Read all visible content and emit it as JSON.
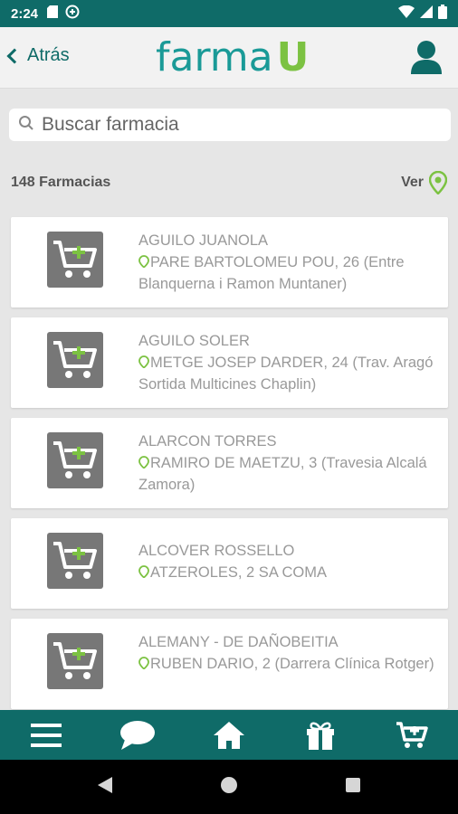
{
  "status_bar": {
    "time": "2:24",
    "icons": [
      "sd-card-icon",
      "sync-icon",
      "wifi-icon",
      "signal-icon",
      "battery-icon"
    ]
  },
  "header": {
    "back_label": "Atrás",
    "logo_main": "farma",
    "logo_accent": "U",
    "profile_icon": "user-icon"
  },
  "search": {
    "placeholder": "Buscar farmacia",
    "value": ""
  },
  "results": {
    "count_label": "148 Farmacias",
    "view_label": "Ver"
  },
  "pharmacies": [
    {
      "name": "AGUILO JUANOLA",
      "address": "PARE BARTOLOMEU POU, 26 (Entre Blanquerna i Ramon Muntaner)"
    },
    {
      "name": "AGUILO SOLER",
      "address": "METGE JOSEP DARDER, 24 (Trav. Aragó Sortida Multicines Chaplin)"
    },
    {
      "name": "ALARCON TORRES",
      "address": "RAMIRO DE MAETZU, 3 (Travesia Alcalá Zamora)"
    },
    {
      "name": "ALCOVER ROSSELLO",
      "address": "ATZEROLES, 2 SA COMA"
    },
    {
      "name": "ALEMANY - DE DAÑOBEITIA",
      "address": "RUBEN DARIO, 2 (Darrera Clínica Rotger)"
    }
  ],
  "bottom_nav": [
    "menu-icon",
    "chat-icon",
    "home-icon",
    "gift-icon",
    "cart-add-icon"
  ],
  "colors": {
    "primary": "#0f6b68",
    "accent_green": "#7cc242",
    "logo_teal": "#1a9a97"
  }
}
